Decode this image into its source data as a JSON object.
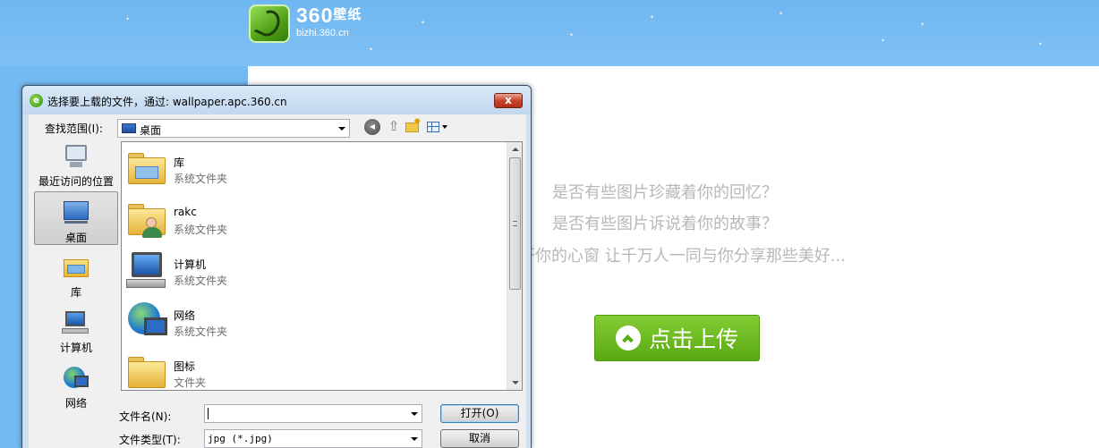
{
  "site": {
    "logo_title": "360",
    "logo_title_cn": "壁纸",
    "logo_url": "bizhi.360.cn",
    "taglines": [
      "是否有些图片珍藏着你的回忆？",
      "是否有些图片诉说着你的故事？",
      "打开你的心窗 让千万人一同与你分享那些美好..."
    ],
    "upload_button": "点击上传",
    "colors": {
      "sky": "#74baf2",
      "upload_green": "#6ab822",
      "tagline_gray": "#b8b8b8"
    }
  },
  "dialog": {
    "title": "选择要上载的文件，通过: wallpaper.apc.360.cn",
    "close_glyph": "x",
    "look_in_label": "查找范围(I):",
    "look_in_value": "桌面",
    "toolbar_icons": [
      "back-icon",
      "up-folder-icon",
      "new-folder-icon",
      "views-menu-icon"
    ],
    "places": [
      {
        "label": "最近访问的位置",
        "icon": "recent-places-icon"
      },
      {
        "label": "桌面",
        "icon": "desktop-icon",
        "selected": true
      },
      {
        "label": "库",
        "icon": "libraries-icon"
      },
      {
        "label": "计算机",
        "icon": "computer-icon"
      },
      {
        "label": "网络",
        "icon": "network-icon"
      }
    ],
    "files": [
      {
        "name": "库",
        "type": "系统文件夹",
        "icon": "libraries-folder-icon"
      },
      {
        "name": "rakc",
        "type": "系统文件夹",
        "icon": "user-folder-icon"
      },
      {
        "name": "计算机",
        "type": "系统文件夹",
        "icon": "computer-icon"
      },
      {
        "name": "网络",
        "type": "系统文件夹",
        "icon": "network-icon"
      },
      {
        "name": "图标",
        "type": "文件夹",
        "icon": "folder-icon"
      }
    ],
    "file_name_label": "文件名(N):",
    "file_name_value": "",
    "file_type_label": "文件类型(T):",
    "file_type_value": "jpg (*.jpg)",
    "open_button": "打开(O)",
    "cancel_button": "取消"
  }
}
